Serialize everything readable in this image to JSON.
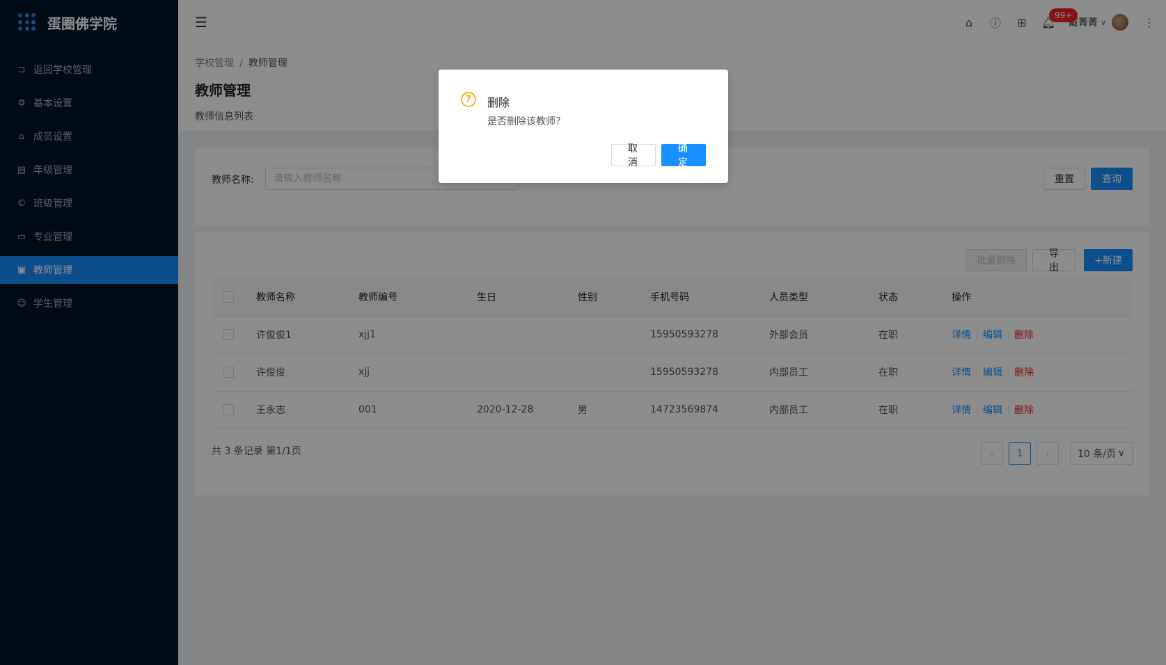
{
  "app": {
    "title": "蛋圈佛学院"
  },
  "sidebar": {
    "items": [
      {
        "label": "返回学校管理",
        "icon": "return-icon"
      },
      {
        "label": "基本设置",
        "icon": "gear-icon"
      },
      {
        "label": "成员设置",
        "icon": "home-icon"
      },
      {
        "label": "年级管理",
        "icon": "grade-icon"
      },
      {
        "label": "班级管理",
        "icon": "copyright-icon"
      },
      {
        "label": "专业管理",
        "icon": "laptop-icon"
      },
      {
        "label": "教师管理",
        "icon": "id-card-icon",
        "active": true
      },
      {
        "label": "学生管理",
        "icon": "user-icon"
      }
    ]
  },
  "header": {
    "notification_count": "99+",
    "username": "戴菁菁"
  },
  "breadcrumb": {
    "parent": "学校管理",
    "separator": "/",
    "current": "教师管理"
  },
  "page": {
    "title": "教师管理",
    "description": "教师信息列表"
  },
  "search": {
    "label": "教师名称:",
    "placeholder": "请输入教师名称",
    "value": "",
    "reset_label": "重置",
    "query_label": "查询"
  },
  "toolbar": {
    "batch_delete_label": "批量删除",
    "export_label": "导 出",
    "new_label": "+新建"
  },
  "table": {
    "columns": [
      "教师名称",
      "教师编号",
      "生日",
      "性别",
      "手机号码",
      "人员类型",
      "状态",
      "操作"
    ],
    "rows": [
      {
        "name": "许俊俊1",
        "code": "xjj1",
        "birthday": "",
        "gender": "",
        "phone": "15950593278",
        "type": "外部会员",
        "status": "在职"
      },
      {
        "name": "许俊俊",
        "code": "xjj",
        "birthday": "",
        "gender": "",
        "phone": "15950593278",
        "type": "内部员工",
        "status": "在职"
      },
      {
        "name": "王永志",
        "code": "001",
        "birthday": "2020-12-28",
        "gender": "男",
        "phone": "14723569874",
        "type": "内部员工",
        "status": "在职"
      }
    ],
    "actions": {
      "detail": "详情",
      "edit": "编辑",
      "delete": "删除"
    }
  },
  "pagination": {
    "summary": "共 3 条记录 第1/1页",
    "current_page": "1",
    "page_size": "10 条/页"
  },
  "modal": {
    "title": "删除",
    "content": "是否删除该教师？",
    "cancel_label": "取 消",
    "ok_label": "确 定"
  },
  "colors": {
    "primary": "#1890ff",
    "sidebar_bg": "#001529",
    "danger": "#f5222d",
    "warning": "#faad14"
  }
}
